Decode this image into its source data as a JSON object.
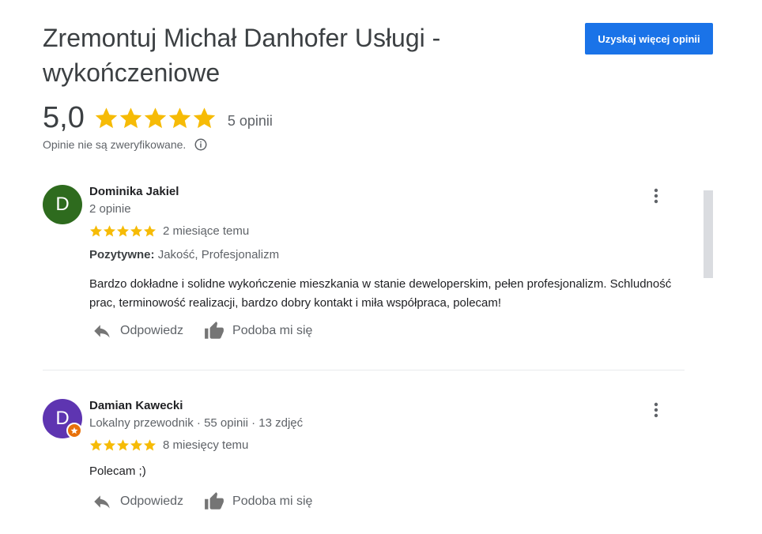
{
  "business": {
    "title": "Zremontuj Michał Danhofer Usługi - wykończeniowe",
    "cta_label": "Uzyskaj więcej opinii",
    "rating": "5,0",
    "stars": 5,
    "reviews_count": "5 opinii",
    "verification_note": "Opinie nie są zweryfikowane."
  },
  "colors": {
    "star": "#f6bb06",
    "accent": "#1a73e8"
  },
  "reviews": [
    {
      "initial": "D",
      "avatar_color": "#2e6b1e",
      "name": "Dominika Jakiel",
      "meta": "2 opinie",
      "stars": 5,
      "when": "2 miesiące temu",
      "positives_label": "Pozytywne:",
      "positives": "Jakość, Profesjonalizm",
      "text": "Bardzo dokładne i solidne wykończenie mieszkania w stanie deweloperskim, pełen profesjonalizm. Schludność prac, terminowość realizacji, bardzo dobry kontakt i miła współpraca, polecam!",
      "reply_label": "Odpowiedz",
      "like_label": "Podoba mi się"
    },
    {
      "initial": "D",
      "avatar_color": "#5e35b1",
      "local_guide": true,
      "name": "Damian Kawecki",
      "meta": "Lokalny przewodnik · 55 opinii · 13 zdjęć",
      "stars": 5,
      "when": "8 miesięcy temu",
      "text": "Polecam ;)",
      "reply_label": "Odpowiedz",
      "like_label": "Podoba mi się"
    }
  ]
}
